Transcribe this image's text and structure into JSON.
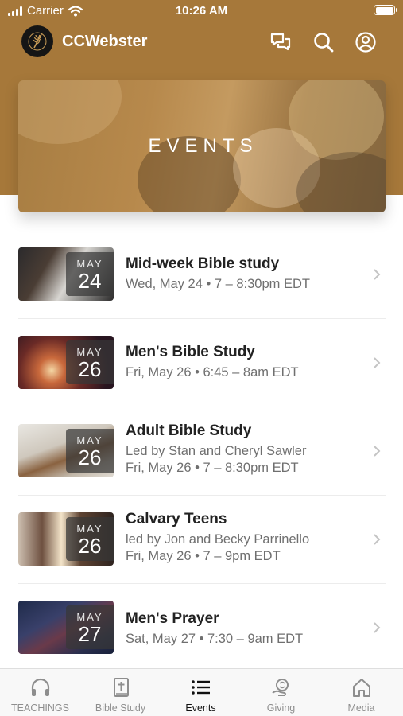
{
  "status_bar": {
    "carrier": "Carrier",
    "time": "10:26 AM"
  },
  "header": {
    "app_name": "CCWebster",
    "icons": [
      "chat-icon",
      "search-icon",
      "profile-icon"
    ]
  },
  "hero": {
    "title": "EVENTS"
  },
  "events": [
    {
      "month": "MAY",
      "day": "24",
      "title": "Mid-week Bible study",
      "lines": [
        "Wed, May 24 • 7 – 8:30pm EDT"
      ]
    },
    {
      "month": "MAY",
      "day": "26",
      "title": "Men's Bible Study",
      "lines": [
        "Fri, May 26 • 6:45 – 8am EDT"
      ]
    },
    {
      "month": "MAY",
      "day": "26",
      "title": "Adult Bible Study",
      "lines": [
        "Led by Stan and Cheryl Sawler",
        "Fri, May 26 • 7 – 8:30pm EDT"
      ]
    },
    {
      "month": "MAY",
      "day": "26",
      "title": "Calvary Teens",
      "lines": [
        "led by Jon and Becky Parrinello",
        "Fri, May 26 • 7 – 9pm EDT"
      ]
    },
    {
      "month": "MAY",
      "day": "27",
      "title": "Men's Prayer",
      "lines": [
        "Sat, May 27 • 7:30 – 9am EDT"
      ]
    }
  ],
  "tab_bar": [
    {
      "label": "TEACHINGS",
      "icon": "headphones-icon",
      "active": false
    },
    {
      "label": "Bible Study",
      "icon": "bible-icon",
      "active": false
    },
    {
      "label": "Events",
      "icon": "list-icon",
      "active": true
    },
    {
      "label": "Giving",
      "icon": "giving-icon",
      "active": false
    },
    {
      "label": "Media",
      "icon": "home-icon",
      "active": false
    }
  ],
  "colors": {
    "brand": "#a6783a",
    "active_tab": "#111111",
    "inactive_tab": "#8e8e8e"
  }
}
